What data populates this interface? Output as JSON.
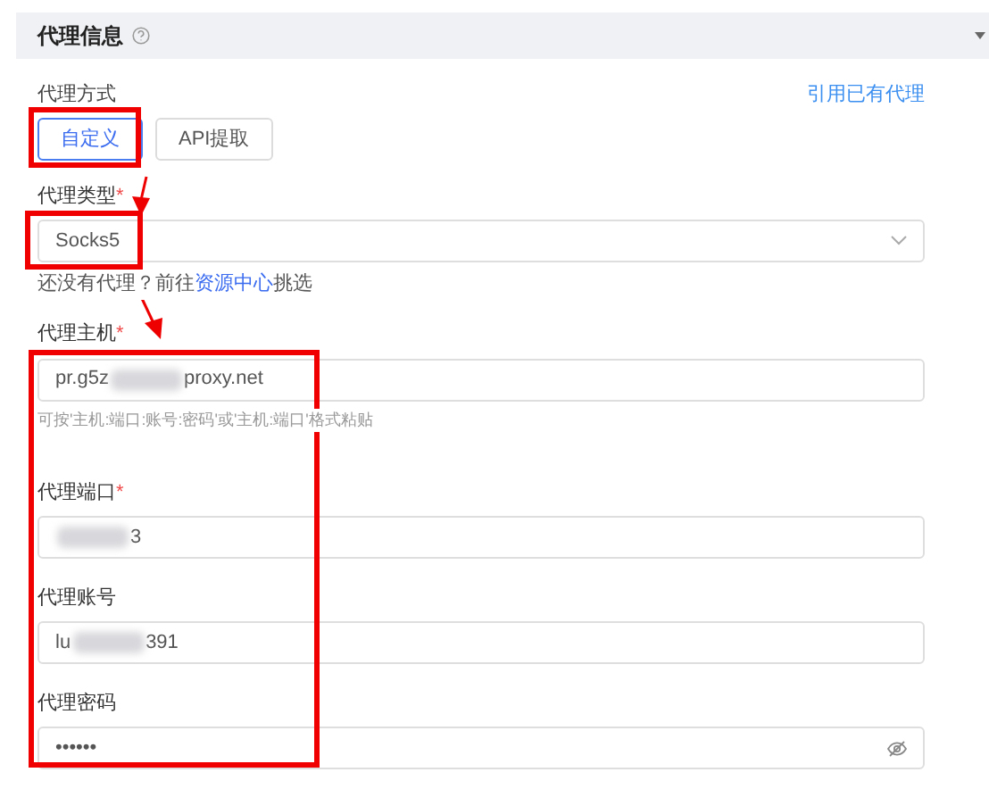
{
  "section": {
    "title": "代理信息",
    "expanded": true
  },
  "method": {
    "label": "代理方式",
    "link": "引用已有代理",
    "options": [
      {
        "label": "自定义",
        "selected": true
      },
      {
        "label": "API提取",
        "selected": false
      }
    ]
  },
  "fields": [
    {
      "kind": "select",
      "label": "代理类型",
      "required_mark": "*",
      "value_parts": [
        {
          "kind": "text",
          "text": "Socks5"
        }
      ],
      "hint_parts": [
        {
          "kind": "text",
          "text": "还没有代理？前往"
        },
        {
          "kind": "link",
          "text": "资源中心"
        },
        {
          "kind": "text",
          "text": "挑选"
        }
      ]
    },
    {
      "kind": "text",
      "label": "代理主机",
      "required_mark": "*",
      "value_parts": [
        {
          "kind": "text",
          "text": "pr.g5z"
        },
        {
          "kind": "blur"
        },
        {
          "kind": "text",
          "text": "proxy.net"
        }
      ],
      "hint_parts": [
        {
          "kind": "text",
          "text": "可按'主机:端口:账号:密码'或'主机:端口'格式粘贴"
        }
      ]
    },
    {
      "kind": "text",
      "label": "代理端口",
      "required_mark": "*",
      "value_parts": [
        {
          "kind": "blur"
        },
        {
          "kind": "text",
          "text": "3"
        }
      ]
    },
    {
      "kind": "text",
      "label": "代理账号",
      "value_parts": [
        {
          "kind": "text",
          "text": "lu"
        },
        {
          "kind": "blur"
        },
        {
          "kind": "text",
          "text": "391"
        }
      ]
    },
    {
      "kind": "password",
      "label": "代理密码",
      "value_parts": [
        {
          "kind": "text",
          "text": "••••••"
        }
      ]
    }
  ]
}
